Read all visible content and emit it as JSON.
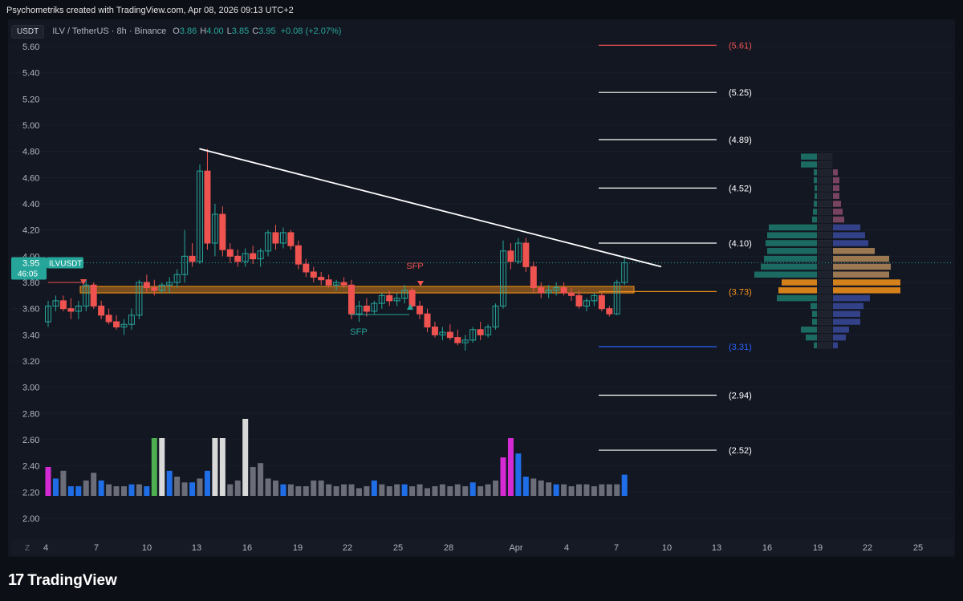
{
  "header": {
    "credit": "Psychometriks created with TradingView.com, Apr 08, 2026 09:13 UTC+2"
  },
  "symbol_bar": {
    "currency_button": "USDT",
    "symbol": "ILV / TetherUS · 8h · Binance",
    "o_label": "O",
    "o": "3.86",
    "h_label": "H",
    "h": "4.00",
    "l_label": "L",
    "l": "3.85",
    "c_label": "C",
    "c": "3.95",
    "change": "+0.08 (+2.07%)"
  },
  "price_badge": {
    "ticker": "ILVUSDT",
    "price": "3.95",
    "countdown": "46:05"
  },
  "logo": {
    "text": "TradingView"
  },
  "time_axis_z": "Z",
  "colors": {
    "bull": "#26a69a",
    "bear": "#ef5350",
    "zone": "#f7931a",
    "trend": "#ffffff",
    "vol_blue": "#1f6ee8",
    "vol_gray": "#6b6e78",
    "vol_magenta": "#d42ad4"
  },
  "chart_data": {
    "type": "candlestick",
    "ylim": [
      1.85,
      5.7
    ],
    "y_ticks": [
      "5.60",
      "5.40",
      "5.20",
      "5.00",
      "4.80",
      "4.60",
      "4.40",
      "4.20",
      "4.00",
      "3.80",
      "3.60",
      "3.40",
      "3.20",
      "3.00",
      "2.80",
      "2.60",
      "2.40",
      "2.20",
      "2.00"
    ],
    "x_ticks": [
      "4",
      "7",
      "10",
      "13",
      "16",
      "19",
      "22",
      "25",
      "28",
      "Apr",
      "4",
      "7",
      "10",
      "13",
      "16",
      "19",
      "22",
      "25"
    ],
    "candles_ohlc": [
      [
        3.5,
        3.66,
        3.46,
        3.62
      ],
      [
        3.62,
        3.7,
        3.58,
        3.66
      ],
      [
        3.66,
        3.7,
        3.58,
        3.6
      ],
      [
        3.6,
        3.68,
        3.52,
        3.58
      ],
      [
        3.58,
        3.66,
        3.52,
        3.62
      ],
      [
        3.62,
        3.82,
        3.58,
        3.78
      ],
      [
        3.78,
        3.8,
        3.6,
        3.62
      ],
      [
        3.62,
        3.66,
        3.52,
        3.55
      ],
      [
        3.55,
        3.6,
        3.48,
        3.5
      ],
      [
        3.5,
        3.55,
        3.44,
        3.46
      ],
      [
        3.46,
        3.52,
        3.4,
        3.48
      ],
      [
        3.48,
        3.6,
        3.44,
        3.55
      ],
      [
        3.55,
        3.82,
        3.52,
        3.8
      ],
      [
        3.8,
        3.86,
        3.72,
        3.76
      ],
      [
        3.76,
        3.82,
        3.7,
        3.74
      ],
      [
        3.74,
        3.8,
        3.72,
        3.78
      ],
      [
        3.78,
        3.84,
        3.72,
        3.8
      ],
      [
        3.8,
        3.9,
        3.76,
        3.86
      ],
      [
        3.86,
        4.2,
        3.8,
        4.0
      ],
      [
        4.0,
        4.1,
        3.92,
        3.96
      ],
      [
        3.96,
        4.7,
        3.94,
        4.65
      ],
      [
        4.65,
        4.82,
        4.05,
        4.1
      ],
      [
        4.1,
        4.4,
        4.0,
        4.32
      ],
      [
        4.32,
        4.38,
        4.0,
        4.05
      ],
      [
        4.05,
        4.1,
        3.95,
        4.0
      ],
      [
        4.0,
        4.05,
        3.92,
        3.96
      ],
      [
        3.96,
        4.06,
        3.92,
        4.02
      ],
      [
        4.02,
        4.08,
        3.94,
        3.98
      ],
      [
        3.98,
        4.06,
        3.92,
        4.04
      ],
      [
        4.04,
        4.2,
        4.0,
        4.18
      ],
      [
        4.18,
        4.24,
        4.05,
        4.1
      ],
      [
        4.1,
        4.22,
        4.06,
        4.18
      ],
      [
        4.18,
        4.2,
        4.05,
        4.08
      ],
      [
        4.08,
        4.12,
        3.9,
        3.94
      ],
      [
        3.94,
        3.98,
        3.84,
        3.88
      ],
      [
        3.88,
        3.92,
        3.8,
        3.84
      ],
      [
        3.84,
        3.88,
        3.78,
        3.82
      ],
      [
        3.82,
        3.86,
        3.76,
        3.78
      ],
      [
        3.78,
        3.82,
        3.74,
        3.8
      ],
      [
        3.8,
        3.84,
        3.76,
        3.78
      ],
      [
        3.78,
        3.82,
        3.52,
        3.56
      ],
      [
        3.56,
        3.66,
        3.5,
        3.62
      ],
      [
        3.62,
        3.68,
        3.54,
        3.58
      ],
      [
        3.58,
        3.66,
        3.56,
        3.64
      ],
      [
        3.64,
        3.72,
        3.6,
        3.7
      ],
      [
        3.7,
        3.74,
        3.62,
        3.66
      ],
      [
        3.66,
        3.72,
        3.62,
        3.68
      ],
      [
        3.68,
        3.78,
        3.64,
        3.74
      ],
      [
        3.74,
        3.76,
        3.6,
        3.62
      ],
      [
        3.62,
        3.66,
        3.52,
        3.56
      ],
      [
        3.56,
        3.6,
        3.42,
        3.46
      ],
      [
        3.46,
        3.5,
        3.38,
        3.4
      ],
      [
        3.4,
        3.46,
        3.36,
        3.42
      ],
      [
        3.42,
        3.48,
        3.36,
        3.38
      ],
      [
        3.38,
        3.44,
        3.32,
        3.34
      ],
      [
        3.34,
        3.4,
        3.28,
        3.36
      ],
      [
        3.36,
        3.46,
        3.34,
        3.44
      ],
      [
        3.44,
        3.5,
        3.36,
        3.4
      ],
      [
        3.4,
        3.48,
        3.38,
        3.46
      ],
      [
        3.46,
        3.64,
        3.44,
        3.62
      ],
      [
        3.62,
        4.12,
        3.6,
        4.04
      ],
      [
        4.04,
        4.1,
        3.9,
        3.96
      ],
      [
        3.96,
        4.14,
        3.94,
        4.1
      ],
      [
        4.1,
        4.14,
        3.88,
        3.92
      ],
      [
        3.92,
        3.96,
        3.72,
        3.76
      ],
      [
        3.76,
        3.8,
        3.68,
        3.72
      ],
      [
        3.72,
        3.78,
        3.68,
        3.74
      ],
      [
        3.74,
        3.8,
        3.7,
        3.76
      ],
      [
        3.76,
        3.8,
        3.7,
        3.72
      ],
      [
        3.72,
        3.76,
        3.66,
        3.7
      ],
      [
        3.7,
        3.74,
        3.6,
        3.62
      ],
      [
        3.62,
        3.68,
        3.58,
        3.66
      ],
      [
        3.66,
        3.72,
        3.62,
        3.7
      ],
      [
        3.7,
        3.72,
        3.58,
        3.6
      ],
      [
        3.6,
        3.62,
        3.54,
        3.56
      ],
      [
        3.56,
        3.82,
        3.55,
        3.8
      ],
      [
        3.8,
        4.0,
        3.78,
        3.95
      ]
    ],
    "volumes": [
      30,
      18,
      26,
      10,
      10,
      16,
      24,
      16,
      12,
      10,
      10,
      12,
      12,
      10,
      60,
      60,
      26,
      20,
      14,
      14,
      18,
      26,
      60,
      60,
      12,
      16,
      80,
      30,
      34,
      18,
      16,
      12,
      12,
      10,
      10,
      16,
      16,
      12,
      10,
      12,
      12,
      8,
      10,
      16,
      12,
      10,
      12,
      12,
      10,
      12,
      8,
      10,
      12,
      10,
      12,
      10,
      14,
      10,
      12,
      16,
      40,
      60,
      44,
      20,
      18,
      16,
      14,
      12,
      12,
      10,
      12,
      12,
      10,
      12,
      12,
      12,
      22
    ],
    "vol_colors": [
      "m",
      "b",
      "g",
      "b",
      "b",
      "g",
      "g",
      "b",
      "g",
      "g",
      "g",
      "b",
      "g",
      "b",
      "G",
      "w",
      "b",
      "g",
      "g",
      "b",
      "g",
      "b",
      "w",
      "w",
      "g",
      "g",
      "w",
      "g",
      "g",
      "g",
      "g",
      "b",
      "g",
      "g",
      "g",
      "g",
      "g",
      "g",
      "g",
      "g",
      "g",
      "g",
      "g",
      "b",
      "g",
      "g",
      "g",
      "b",
      "g",
      "g",
      "g",
      "g",
      "g",
      "g",
      "g",
      "g",
      "b",
      "g",
      "g",
      "g",
      "m",
      "m",
      "b",
      "b",
      "g",
      "g",
      "g",
      "b",
      "g",
      "g",
      "g",
      "g",
      "g",
      "g",
      "g",
      "g",
      "b"
    ],
    "trendline": {
      "from": {
        "idx": 21,
        "price": 4.82
      },
      "to": {
        "idx": 84,
        "price": 3.92
      }
    },
    "zone": {
      "top": 3.77,
      "bottom": 3.72
    },
    "fib_levels": [
      {
        "label": "(5.61)",
        "price": 5.61,
        "color": "#ef5350"
      },
      {
        "label": "(5.25)",
        "price": 5.25,
        "color": "#ffffff"
      },
      {
        "label": "(4.89)",
        "price": 4.89,
        "color": "#ffffff"
      },
      {
        "label": "(4.52)",
        "price": 4.52,
        "color": "#ffffff"
      },
      {
        "label": "(4.10)",
        "price": 4.1,
        "color": "#ffffff"
      },
      {
        "label": "(3.73)",
        "price": 3.73,
        "color": "#f7931a"
      },
      {
        "label": "(3.31)",
        "price": 3.31,
        "color": "#2962ff"
      },
      {
        "label": "(2.94)",
        "price": 2.94,
        "color": "#ffffff"
      },
      {
        "label": "(2.52)",
        "price": 2.52,
        "color": "#ffffff"
      }
    ],
    "annotations": [
      {
        "text": "SFP",
        "color": "#ef5350"
      },
      {
        "text": "SFP",
        "color": "#26a69a"
      }
    ],
    "volume_profile": [
      {
        "price": 4.76,
        "buy": 20,
        "sell": 0
      },
      {
        "price": 4.7,
        "buy": 20,
        "sell": 0
      },
      {
        "price": 4.64,
        "buy": 4,
        "sell": 6
      },
      {
        "price": 4.58,
        "buy": 4,
        "sell": 8
      },
      {
        "price": 4.52,
        "buy": 3,
        "sell": 8
      },
      {
        "price": 4.46,
        "buy": 3,
        "sell": 8
      },
      {
        "price": 4.4,
        "buy": 4,
        "sell": 10
      },
      {
        "price": 4.34,
        "buy": 5,
        "sell": 12
      },
      {
        "price": 4.28,
        "buy": 6,
        "sell": 14
      },
      {
        "price": 4.22,
        "buy": 60,
        "sell": 34
      },
      {
        "price": 4.16,
        "buy": 62,
        "sell": 40
      },
      {
        "price": 4.1,
        "buy": 64,
        "sell": 44
      },
      {
        "price": 4.04,
        "buy": 62,
        "sell": 52
      },
      {
        "price": 3.98,
        "buy": 66,
        "sell": 70
      },
      {
        "price": 3.92,
        "buy": 70,
        "sell": 72
      },
      {
        "price": 3.86,
        "buy": 78,
        "sell": 70
      },
      {
        "price": 3.8,
        "buy": 44,
        "sell": 84
      },
      {
        "price": 3.74,
        "buy": 48,
        "sell": 84
      },
      {
        "price": 3.68,
        "buy": 50,
        "sell": 46
      },
      {
        "price": 3.62,
        "buy": 8,
        "sell": 38
      },
      {
        "price": 3.56,
        "buy": 6,
        "sell": 34
      },
      {
        "price": 3.5,
        "buy": 6,
        "sell": 34
      },
      {
        "price": 3.44,
        "buy": 20,
        "sell": 20
      },
      {
        "price": 3.38,
        "buy": 14,
        "sell": 16
      },
      {
        "price": 3.32,
        "buy": 4,
        "sell": 6
      }
    ]
  }
}
